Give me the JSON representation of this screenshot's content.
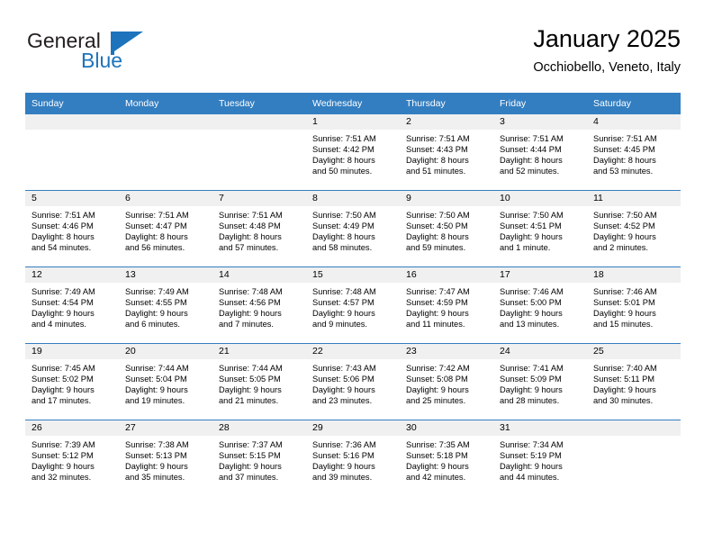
{
  "brand": {
    "name_part1": "General",
    "name_part2": "Blue",
    "flag_icon": "triangle-flag-icon",
    "accent_color": "#1d74bc"
  },
  "header": {
    "title": "January 2025",
    "subtitle": "Occhiobello, Veneto, Italy"
  },
  "calendar": {
    "header_bg": "#337ec1",
    "daynum_bg": "#f0f0f0",
    "weekday_names": [
      "Sunday",
      "Monday",
      "Tuesday",
      "Wednesday",
      "Thursday",
      "Friday",
      "Saturday"
    ],
    "weeks": [
      [
        {
          "day": "",
          "sunrise": "",
          "sunset": "",
          "daylight_line1": "",
          "daylight_line2": ""
        },
        {
          "day": "",
          "sunrise": "",
          "sunset": "",
          "daylight_line1": "",
          "daylight_line2": ""
        },
        {
          "day": "",
          "sunrise": "",
          "sunset": "",
          "daylight_line1": "",
          "daylight_line2": ""
        },
        {
          "day": "1",
          "sunrise": "Sunrise: 7:51 AM",
          "sunset": "Sunset: 4:42 PM",
          "daylight_line1": "Daylight: 8 hours",
          "daylight_line2": "and 50 minutes."
        },
        {
          "day": "2",
          "sunrise": "Sunrise: 7:51 AM",
          "sunset": "Sunset: 4:43 PM",
          "daylight_line1": "Daylight: 8 hours",
          "daylight_line2": "and 51 minutes."
        },
        {
          "day": "3",
          "sunrise": "Sunrise: 7:51 AM",
          "sunset": "Sunset: 4:44 PM",
          "daylight_line1": "Daylight: 8 hours",
          "daylight_line2": "and 52 minutes."
        },
        {
          "day": "4",
          "sunrise": "Sunrise: 7:51 AM",
          "sunset": "Sunset: 4:45 PM",
          "daylight_line1": "Daylight: 8 hours",
          "daylight_line2": "and 53 minutes."
        }
      ],
      [
        {
          "day": "5",
          "sunrise": "Sunrise: 7:51 AM",
          "sunset": "Sunset: 4:46 PM",
          "daylight_line1": "Daylight: 8 hours",
          "daylight_line2": "and 54 minutes."
        },
        {
          "day": "6",
          "sunrise": "Sunrise: 7:51 AM",
          "sunset": "Sunset: 4:47 PM",
          "daylight_line1": "Daylight: 8 hours",
          "daylight_line2": "and 56 minutes."
        },
        {
          "day": "7",
          "sunrise": "Sunrise: 7:51 AM",
          "sunset": "Sunset: 4:48 PM",
          "daylight_line1": "Daylight: 8 hours",
          "daylight_line2": "and 57 minutes."
        },
        {
          "day": "8",
          "sunrise": "Sunrise: 7:50 AM",
          "sunset": "Sunset: 4:49 PM",
          "daylight_line1": "Daylight: 8 hours",
          "daylight_line2": "and 58 minutes."
        },
        {
          "day": "9",
          "sunrise": "Sunrise: 7:50 AM",
          "sunset": "Sunset: 4:50 PM",
          "daylight_line1": "Daylight: 8 hours",
          "daylight_line2": "and 59 minutes."
        },
        {
          "day": "10",
          "sunrise": "Sunrise: 7:50 AM",
          "sunset": "Sunset: 4:51 PM",
          "daylight_line1": "Daylight: 9 hours",
          "daylight_line2": "and 1 minute."
        },
        {
          "day": "11",
          "sunrise": "Sunrise: 7:50 AM",
          "sunset": "Sunset: 4:52 PM",
          "daylight_line1": "Daylight: 9 hours",
          "daylight_line2": "and 2 minutes."
        }
      ],
      [
        {
          "day": "12",
          "sunrise": "Sunrise: 7:49 AM",
          "sunset": "Sunset: 4:54 PM",
          "daylight_line1": "Daylight: 9 hours",
          "daylight_line2": "and 4 minutes."
        },
        {
          "day": "13",
          "sunrise": "Sunrise: 7:49 AM",
          "sunset": "Sunset: 4:55 PM",
          "daylight_line1": "Daylight: 9 hours",
          "daylight_line2": "and 6 minutes."
        },
        {
          "day": "14",
          "sunrise": "Sunrise: 7:48 AM",
          "sunset": "Sunset: 4:56 PM",
          "daylight_line1": "Daylight: 9 hours",
          "daylight_line2": "and 7 minutes."
        },
        {
          "day": "15",
          "sunrise": "Sunrise: 7:48 AM",
          "sunset": "Sunset: 4:57 PM",
          "daylight_line1": "Daylight: 9 hours",
          "daylight_line2": "and 9 minutes."
        },
        {
          "day": "16",
          "sunrise": "Sunrise: 7:47 AM",
          "sunset": "Sunset: 4:59 PM",
          "daylight_line1": "Daylight: 9 hours",
          "daylight_line2": "and 11 minutes."
        },
        {
          "day": "17",
          "sunrise": "Sunrise: 7:46 AM",
          "sunset": "Sunset: 5:00 PM",
          "daylight_line1": "Daylight: 9 hours",
          "daylight_line2": "and 13 minutes."
        },
        {
          "day": "18",
          "sunrise": "Sunrise: 7:46 AM",
          "sunset": "Sunset: 5:01 PM",
          "daylight_line1": "Daylight: 9 hours",
          "daylight_line2": "and 15 minutes."
        }
      ],
      [
        {
          "day": "19",
          "sunrise": "Sunrise: 7:45 AM",
          "sunset": "Sunset: 5:02 PM",
          "daylight_line1": "Daylight: 9 hours",
          "daylight_line2": "and 17 minutes."
        },
        {
          "day": "20",
          "sunrise": "Sunrise: 7:44 AM",
          "sunset": "Sunset: 5:04 PM",
          "daylight_line1": "Daylight: 9 hours",
          "daylight_line2": "and 19 minutes."
        },
        {
          "day": "21",
          "sunrise": "Sunrise: 7:44 AM",
          "sunset": "Sunset: 5:05 PM",
          "daylight_line1": "Daylight: 9 hours",
          "daylight_line2": "and 21 minutes."
        },
        {
          "day": "22",
          "sunrise": "Sunrise: 7:43 AM",
          "sunset": "Sunset: 5:06 PM",
          "daylight_line1": "Daylight: 9 hours",
          "daylight_line2": "and 23 minutes."
        },
        {
          "day": "23",
          "sunrise": "Sunrise: 7:42 AM",
          "sunset": "Sunset: 5:08 PM",
          "daylight_line1": "Daylight: 9 hours",
          "daylight_line2": "and 25 minutes."
        },
        {
          "day": "24",
          "sunrise": "Sunrise: 7:41 AM",
          "sunset": "Sunset: 5:09 PM",
          "daylight_line1": "Daylight: 9 hours",
          "daylight_line2": "and 28 minutes."
        },
        {
          "day": "25",
          "sunrise": "Sunrise: 7:40 AM",
          "sunset": "Sunset: 5:11 PM",
          "daylight_line1": "Daylight: 9 hours",
          "daylight_line2": "and 30 minutes."
        }
      ],
      [
        {
          "day": "26",
          "sunrise": "Sunrise: 7:39 AM",
          "sunset": "Sunset: 5:12 PM",
          "daylight_line1": "Daylight: 9 hours",
          "daylight_line2": "and 32 minutes."
        },
        {
          "day": "27",
          "sunrise": "Sunrise: 7:38 AM",
          "sunset": "Sunset: 5:13 PM",
          "daylight_line1": "Daylight: 9 hours",
          "daylight_line2": "and 35 minutes."
        },
        {
          "day": "28",
          "sunrise": "Sunrise: 7:37 AM",
          "sunset": "Sunset: 5:15 PM",
          "daylight_line1": "Daylight: 9 hours",
          "daylight_line2": "and 37 minutes."
        },
        {
          "day": "29",
          "sunrise": "Sunrise: 7:36 AM",
          "sunset": "Sunset: 5:16 PM",
          "daylight_line1": "Daylight: 9 hours",
          "daylight_line2": "and 39 minutes."
        },
        {
          "day": "30",
          "sunrise": "Sunrise: 7:35 AM",
          "sunset": "Sunset: 5:18 PM",
          "daylight_line1": "Daylight: 9 hours",
          "daylight_line2": "and 42 minutes."
        },
        {
          "day": "31",
          "sunrise": "Sunrise: 7:34 AM",
          "sunset": "Sunset: 5:19 PM",
          "daylight_line1": "Daylight: 9 hours",
          "daylight_line2": "and 44 minutes."
        },
        {
          "day": "",
          "sunrise": "",
          "sunset": "",
          "daylight_line1": "",
          "daylight_line2": ""
        }
      ]
    ]
  }
}
